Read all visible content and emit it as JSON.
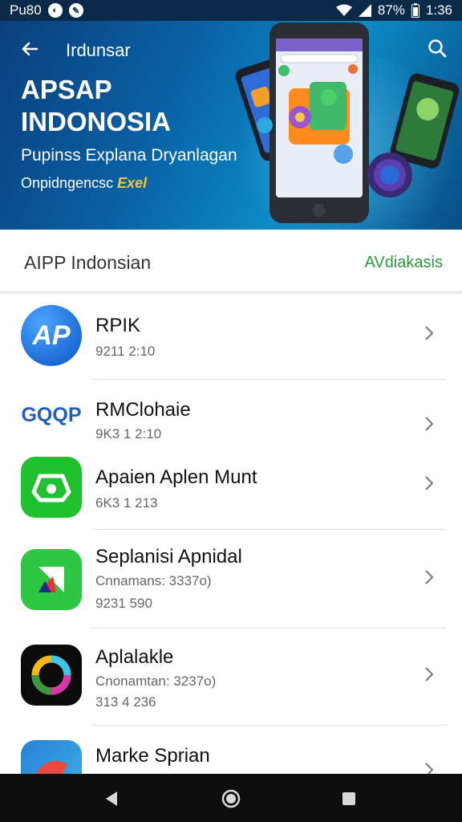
{
  "status_bar": {
    "carrier": "Pu80",
    "battery": "87%",
    "time": "1:36"
  },
  "hero": {
    "nav_title": "Irdunsar",
    "title": "APSAP INDONOSIA",
    "subtitle": "Pupinss Explana Dryanlagan",
    "tagline": "Onpidngencsc",
    "tagline_accent": "Exel"
  },
  "section": {
    "title": "AIPP Indonsian",
    "link": "AVdiakasis"
  },
  "apps": [
    {
      "name": "RPIK",
      "meta": "9211 2:10"
    },
    {
      "name": "RMClohaie",
      "meta": "9K3 1 2:10",
      "icon_text": "GQQP"
    },
    {
      "name": "Apaien Aplen Munt",
      "meta": "6K3 1 213"
    },
    {
      "name": "Seplanisi Apnidal",
      "sub": "Cnnamans: 3337o)",
      "meta": "9231 590"
    },
    {
      "name": "Aplalakle",
      "sub": "Cnonamtan: 3237o)",
      "meta": "313 4 236"
    },
    {
      "name": "Marke Sprian"
    }
  ],
  "colors": {
    "accent_green": "#2a9a3a",
    "hero_blue": "#0a5fa3",
    "nav_bg": "#0d0d0d"
  },
  "icons": [
    "back-arrow-icon",
    "search-icon",
    "chevron-right-icon",
    "nav-back-icon",
    "nav-home-icon",
    "nav-recents-icon"
  ]
}
